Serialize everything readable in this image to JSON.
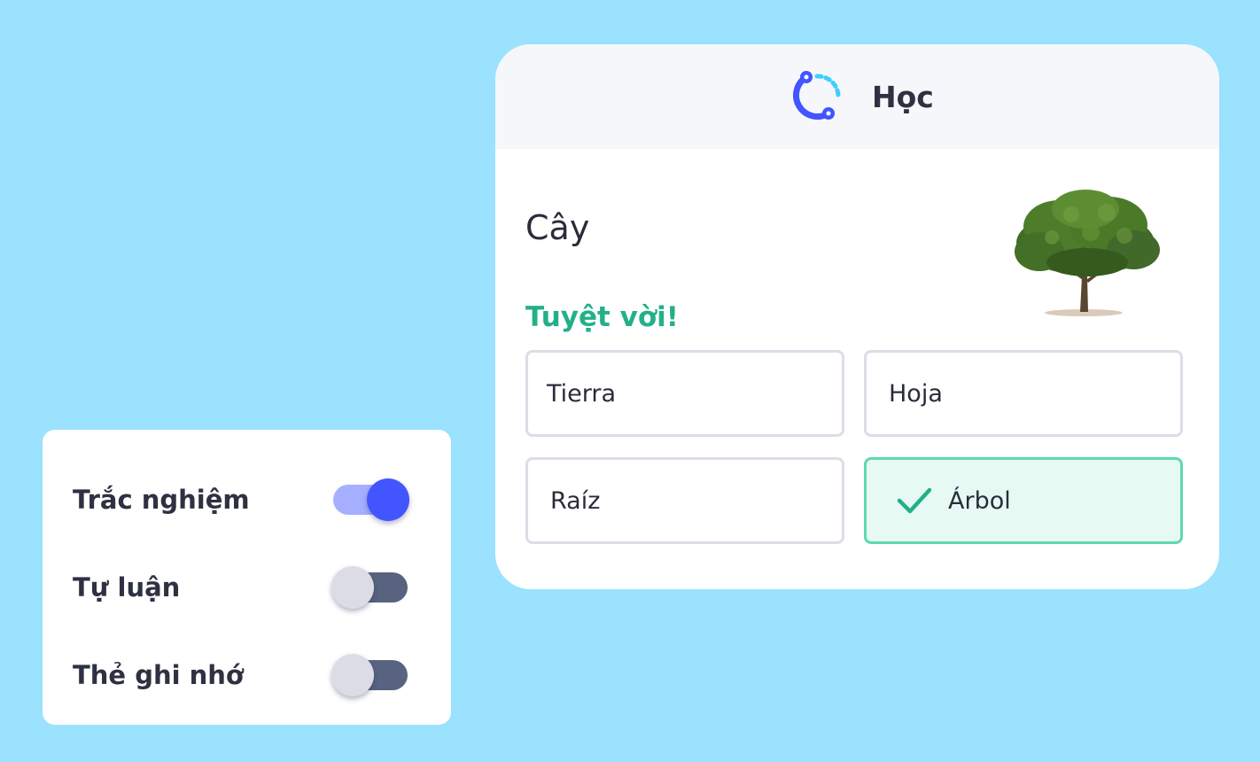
{
  "learn": {
    "title": "Học",
    "term": "Cây",
    "feedback": "Tuyệt vời!",
    "image_icon": "tree-image",
    "options": [
      {
        "label": "Tierra",
        "state": "default"
      },
      {
        "label": "Hoja",
        "state": "default"
      },
      {
        "label": "Raíz",
        "state": "default"
      },
      {
        "label": "Árbol",
        "state": "correct",
        "icon": "check-icon"
      }
    ]
  },
  "settings": {
    "items": [
      {
        "label": "Trắc nghiệm",
        "enabled": true
      },
      {
        "label": "Tự luận",
        "enabled": false
      },
      {
        "label": "Thẻ ghi nhớ",
        "enabled": false
      }
    ]
  },
  "colors": {
    "background": "#9ae2fd",
    "brand_blue": "#4255ff",
    "success_green": "#23b089",
    "correct_border": "#5fd8b0",
    "correct_fill": "#e6faf3",
    "toggle_off_track": "#586380"
  }
}
